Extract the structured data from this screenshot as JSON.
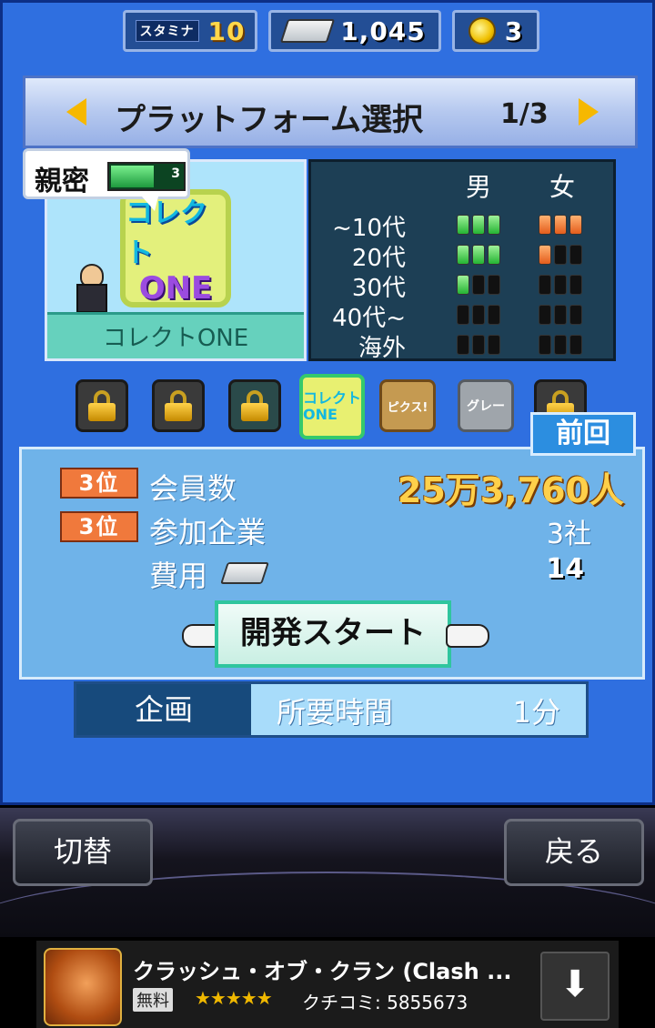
{
  "resources": {
    "stamina_label": "スタミナ",
    "stamina": "10",
    "ingots": "1,045",
    "gold": "3"
  },
  "header": {
    "title": "プラットフォーム選択",
    "page": "1/3"
  },
  "platform": {
    "affinity_label": "親密",
    "affinity_level": "3",
    "affinity_fraction": 0.6,
    "logo_line1": "コレクト",
    "logo_line2": "ONE",
    "name": "コレクトONE"
  },
  "demographics": {
    "male_header": "男",
    "female_header": "女",
    "rows": [
      {
        "age": "~10代",
        "male": 3,
        "female": 3
      },
      {
        "age": "20代",
        "male": 3,
        "female": 1
      },
      {
        "age": "30代",
        "male": 1,
        "female": 0
      },
      {
        "age": "40代~",
        "male": 0,
        "female": 0
      },
      {
        "age": "海外",
        "male": 0,
        "female": 0
      }
    ]
  },
  "platform_icons": [
    {
      "state": "locked",
      "label": ""
    },
    {
      "state": "locked",
      "label": ""
    },
    {
      "state": "locked",
      "label": ""
    },
    {
      "state": "selected",
      "label": "コレクト ONE"
    },
    {
      "state": "available",
      "label": "ピクス!"
    },
    {
      "state": "available",
      "label": "グレー"
    },
    {
      "state": "locked",
      "label": ""
    }
  ],
  "previous_button": "前回",
  "stats": {
    "members_rank": "3位",
    "members_label": "会員数",
    "members_value": "25万3,760人",
    "companies_rank": "3位",
    "companies_label": "参加企業",
    "companies_value": "3社",
    "cost_label": "費用",
    "cost_value": "14"
  },
  "start_button": "開発スタート",
  "plan": {
    "kind": "企画",
    "required_label": "所要時間",
    "duration": "1分"
  },
  "nav": {
    "switch": "切替",
    "back": "戻る"
  },
  "ad": {
    "title": "クラッシュ・オブ・クラン (Clash ...",
    "price": "無料",
    "stars": "★★★★★",
    "reviews": "クチコミ: 5855673"
  }
}
